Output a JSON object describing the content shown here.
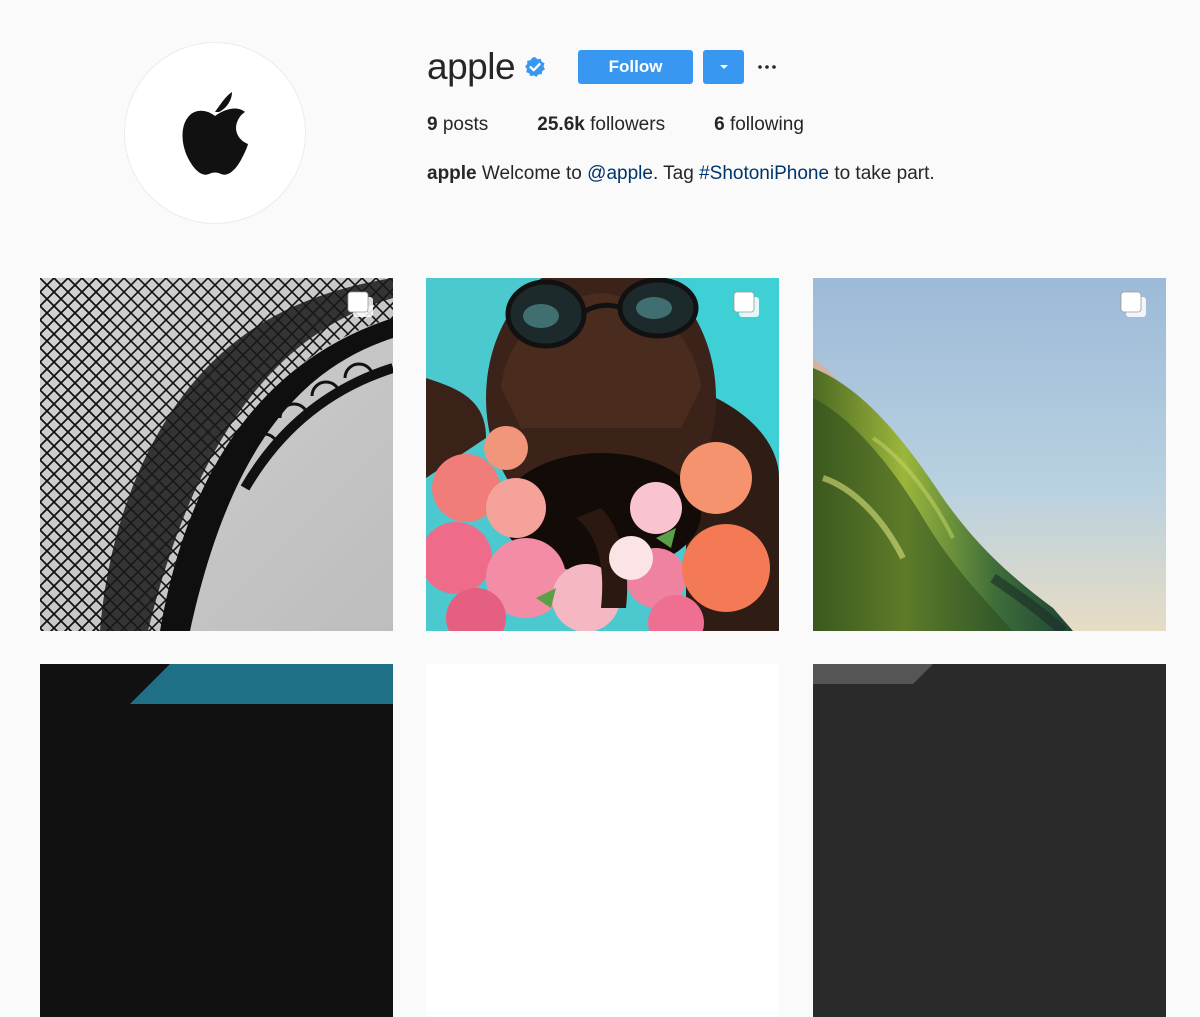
{
  "profile": {
    "username": "apple",
    "verified": true,
    "follow_label": "Follow",
    "posts_count": "9",
    "posts_label": "posts",
    "followers_count": "25.6k",
    "followers_label": "followers",
    "following_count": "6",
    "following_label": "following",
    "bio": {
      "name": "apple",
      "text1": "Welcome to",
      "mention": "@apple",
      "text2": ". Tag",
      "hashtag": "#ShotoniPhone",
      "text3": "to take part."
    }
  },
  "icons": {
    "avatar": "apple-logo-icon",
    "verified": "verified-badge-icon",
    "dropdown": "caret-down-icon",
    "more": "ellipsis-icon",
    "multi_post": "carousel-icon"
  },
  "colors": {
    "accent": "#3897f0",
    "link": "#003569",
    "background": "#fafafa",
    "text": "#262626"
  },
  "posts": [
    {
      "subject": "Eiffel Tower ironwork in black and white",
      "multi": true
    },
    {
      "subject": "Bearded man in sunglasses with roses, pool background",
      "multi": true
    },
    {
      "subject": "Green ocean wave curling under blue sky",
      "multi": true
    },
    {
      "subject": "Partially visible post",
      "multi": false
    },
    {
      "subject": "Partially visible post",
      "multi": false
    },
    {
      "subject": "Partially visible post",
      "multi": false
    }
  ]
}
